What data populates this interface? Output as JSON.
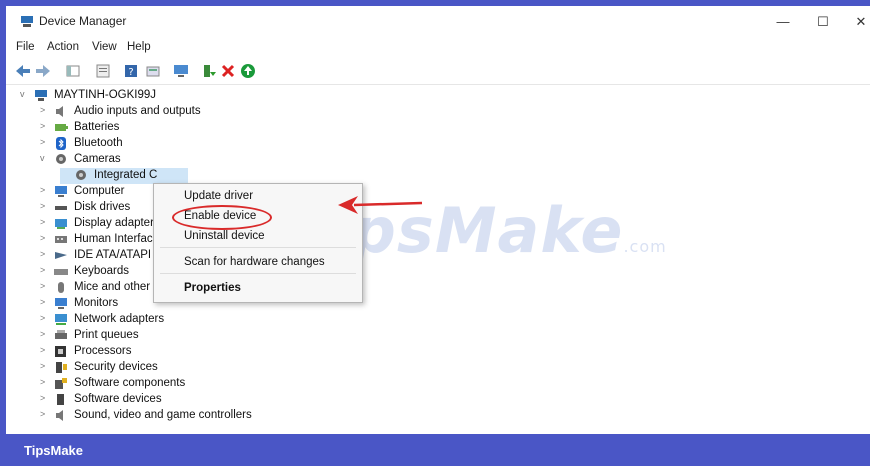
{
  "window": {
    "title": "Device Manager",
    "min": "—",
    "max": "☐",
    "close": "✕"
  },
  "menu": [
    "File",
    "Action",
    "View",
    "Help"
  ],
  "tree": {
    "root": "MAYTINH-OGKI99J",
    "items": [
      {
        "label": "Audio inputs and outputs",
        "chev": ">",
        "icon": "speaker-icon"
      },
      {
        "label": "Batteries",
        "chev": ">",
        "icon": "battery-icon"
      },
      {
        "label": "Bluetooth",
        "chev": ">",
        "icon": "bluetooth-icon"
      },
      {
        "label": "Cameras",
        "chev": "v",
        "icon": "camera-icon"
      },
      {
        "label": "Integrated C",
        "chev": "",
        "icon": "camera-icon",
        "child": true,
        "selected": true
      },
      {
        "label": "Computer",
        "chev": ">",
        "icon": "monitor-icon"
      },
      {
        "label": "Disk drives",
        "chev": ">",
        "icon": "disk-icon"
      },
      {
        "label": "Display adapters",
        "chev": ">",
        "icon": "display-adapter-icon"
      },
      {
        "label": "Human Interface",
        "chev": ">",
        "icon": "hid-icon"
      },
      {
        "label": "IDE ATA/ATAPI co",
        "chev": ">",
        "icon": "ide-icon"
      },
      {
        "label": "Keyboards",
        "chev": ">",
        "icon": "keyboard-icon"
      },
      {
        "label": "Mice and other p",
        "chev": ">",
        "icon": "mouse-icon"
      },
      {
        "label": "Monitors",
        "chev": ">",
        "icon": "monitor-icon"
      },
      {
        "label": "Network adapters",
        "chev": ">",
        "icon": "network-icon"
      },
      {
        "label": "Print queues",
        "chev": ">",
        "icon": "printer-icon"
      },
      {
        "label": "Processors",
        "chev": ">",
        "icon": "processor-icon"
      },
      {
        "label": "Security devices",
        "chev": ">",
        "icon": "security-icon"
      },
      {
        "label": "Software components",
        "chev": ">",
        "icon": "software-components-icon"
      },
      {
        "label": "Software devices",
        "chev": ">",
        "icon": "software-devices-icon"
      },
      {
        "label": "Sound, video and game controllers",
        "chev": ">",
        "icon": "speaker-icon"
      }
    ]
  },
  "context_menu": {
    "update": "Update driver",
    "enable": "Enable device",
    "uninstall": "Uninstall device",
    "scan": "Scan for hardware changes",
    "properties": "Properties"
  },
  "watermark": {
    "main": "TipsMake",
    "suffix": ".com"
  },
  "footer": {
    "label": "TipsMake"
  },
  "colors": {
    "band": "#4a56c6",
    "selection": "#cfe5f7",
    "annotation": "#d92a2a"
  }
}
